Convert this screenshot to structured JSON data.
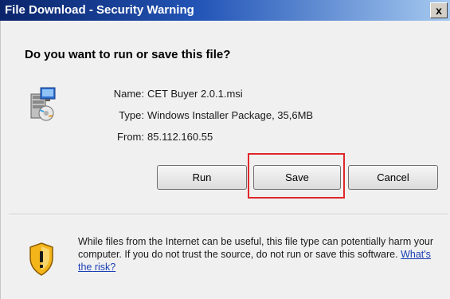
{
  "window": {
    "title": "File Download - Security Warning",
    "close_glyph": "x"
  },
  "dialog": {
    "question": "Do you want to run or save this file?",
    "file": {
      "name_label": "Name:",
      "name_value": "CET Buyer 2.0.1.msi",
      "type_label": "Type:",
      "type_value": "Windows Installer Package, 35,6MB",
      "from_label": "From:",
      "from_value": "85.112.160.55",
      "icon": "msi-installer-icon"
    },
    "buttons": {
      "run_label": "Run",
      "save_label": "Save",
      "cancel_label": "Cancel"
    },
    "highlight_color": "#e0272b",
    "warning": {
      "icon": "shield-warning-icon",
      "text": "While files from the Internet can be useful, this file type can potentially harm your computer. If you do not trust the source, do not run or save this software.",
      "link_text": "What's the risk?"
    }
  }
}
